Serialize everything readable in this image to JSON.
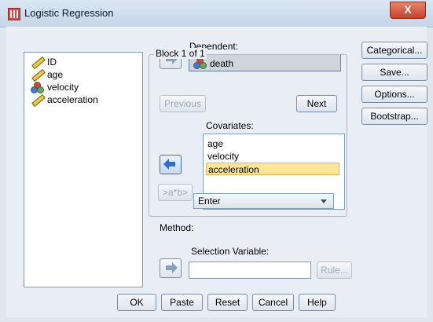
{
  "window": {
    "title": "Logistic Regression",
    "close_symbol": "X"
  },
  "variables": [
    {
      "name": "ID",
      "icon": "ruler-icon"
    },
    {
      "name": "age",
      "icon": "ruler-icon"
    },
    {
      "name": "velocity",
      "icon": "nominal-icon"
    },
    {
      "name": "acceleration",
      "icon": "ruler-icon"
    }
  ],
  "dependent": {
    "label": "Dependent:",
    "value": "death"
  },
  "block": {
    "label": "Block 1 of 1",
    "previous": "Previous",
    "next": "Next"
  },
  "covariates": {
    "label": "Covariates:",
    "items": [
      "age",
      "velocity",
      "acceleration"
    ],
    "selected": "acceleration",
    "interaction_button": ">a*b>"
  },
  "method": {
    "label": "Method:",
    "value": "Enter"
  },
  "selection_variable": {
    "label": "Selection Variable:",
    "rule_button": "Rule..."
  },
  "side_buttons": [
    "Categorical...",
    "Save...",
    "Options...",
    "Bootstrap..."
  ],
  "bottom_buttons": [
    "OK",
    "Paste",
    "Reset",
    "Cancel",
    "Help"
  ],
  "colors": {
    "selected_row": "#fde59a",
    "accent_blue": "#2f6fc6"
  }
}
